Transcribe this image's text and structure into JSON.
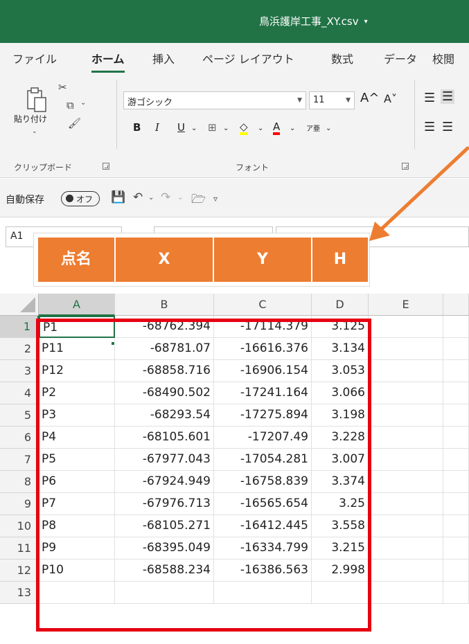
{
  "window": {
    "title": "鳥浜護岸工事_XY.csv",
    "title_caret": "▾"
  },
  "ribbon_tabs": [
    {
      "label": "ファイル"
    },
    {
      "label": "ホーム",
      "active": true
    },
    {
      "label": "挿入"
    },
    {
      "label": "ページ レイアウト"
    },
    {
      "label": "数式"
    },
    {
      "label": "データ"
    },
    {
      "label": "校閲"
    }
  ],
  "clipboard": {
    "paste_label": "貼り付け",
    "group_label": "クリップボード"
  },
  "font_group": {
    "font_name": "游ゴシック",
    "font_size": "11",
    "group_label": "フォント",
    "bold": "B",
    "italic": "I",
    "underline": "U",
    "grow": "A^",
    "shrink": "A˅",
    "font_color_glyph": "A",
    "phonetic_glyph": "ア亜"
  },
  "colors": {
    "excel_green": "#217346",
    "header_orange": "#ed7d31",
    "highlight_red": "#e60012",
    "arrow_orange": "#ed7d31",
    "fill_yellow": "#ffff00",
    "font_red": "#ff0000"
  },
  "qat": {
    "autosave_label": "自動保存",
    "toggle_text": "オフ"
  },
  "name_box": {
    "value": "A1"
  },
  "callout_headers": [
    "点名",
    "X",
    "Y",
    "H"
  ],
  "columns": [
    "A",
    "B",
    "C",
    "D",
    "E"
  ],
  "rows": [
    {
      "num": "1",
      "a": "P1",
      "b": "-68762.394",
      "c": "-17114.379",
      "d": "3.125"
    },
    {
      "num": "2",
      "a": "P11",
      "b": "-68781.07",
      "c": "-16616.376",
      "d": "3.134"
    },
    {
      "num": "3",
      "a": "P12",
      "b": "-68858.716",
      "c": "-16906.154",
      "d": "3.053"
    },
    {
      "num": "4",
      "a": "P2",
      "b": "-68490.502",
      "c": "-17241.164",
      "d": "3.066"
    },
    {
      "num": "5",
      "a": "P3",
      "b": "-68293.54",
      "c": "-17275.894",
      "d": "3.198"
    },
    {
      "num": "6",
      "a": "P4",
      "b": "-68105.601",
      "c": "-17207.49",
      "d": "3.228"
    },
    {
      "num": "7",
      "a": "P5",
      "b": "-67977.043",
      "c": "-17054.281",
      "d": "3.007"
    },
    {
      "num": "8",
      "a": "P6",
      "b": "-67924.949",
      "c": "-16758.839",
      "d": "3.374"
    },
    {
      "num": "9",
      "a": "P7",
      "b": "-67976.713",
      "c": "-16565.654",
      "d": "3.25"
    },
    {
      "num": "10",
      "a": "P8",
      "b": "-68105.271",
      "c": "-16412.445",
      "d": "3.558"
    },
    {
      "num": "11",
      "a": "P9",
      "b": "-68395.049",
      "c": "-16334.799",
      "d": "3.215"
    },
    {
      "num": "12",
      "a": "P10",
      "b": "-68588.234",
      "c": "-16386.563",
      "d": "2.998"
    },
    {
      "num": "13",
      "a": "",
      "b": "",
      "c": "",
      "d": ""
    }
  ]
}
